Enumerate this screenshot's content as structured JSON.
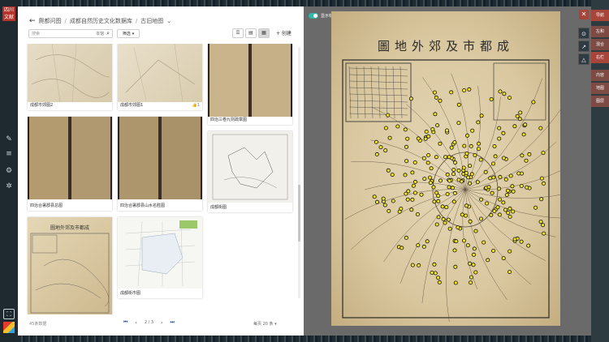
{
  "logo": {
    "text": "四川\n文献"
  },
  "breadcrumb": {
    "items": [
      "爬都问图",
      "成都自然历史文化数据库",
      "古旧地图"
    ]
  },
  "search": {
    "placeholder": "搜索",
    "scope": "本馆"
  },
  "filter": {
    "label": "筛选"
  },
  "new_button": {
    "label": "+ 创建"
  },
  "cards": [
    {
      "caption": "成都市郊图2"
    },
    {
      "caption": "成都市郊图1",
      "likes": "1"
    },
    {
      "caption": "四治三卷九则疏章图"
    },
    {
      "caption": "四治合署郡县总图"
    },
    {
      "caption": "四治合署郡县山水名胜图"
    },
    {
      "caption": "成都街图"
    },
    {
      "caption": ""
    },
    {
      "caption": "成都街市图"
    }
  ],
  "footer": {
    "count": "45条数据",
    "page_info": "2 / 3",
    "per_page": "每页 20 条"
  },
  "viewer": {
    "toggle_label": "显示标注",
    "map_title": "成都市及郊外地圖"
  },
  "right_tabs": [
    "导航",
    "左和",
    "混合",
    "右栏",
    "内容",
    "地图",
    "图层"
  ],
  "colors": {
    "accent": "#a8453b",
    "toggle": "#2fb8a7",
    "link": "#1f4a8a"
  }
}
